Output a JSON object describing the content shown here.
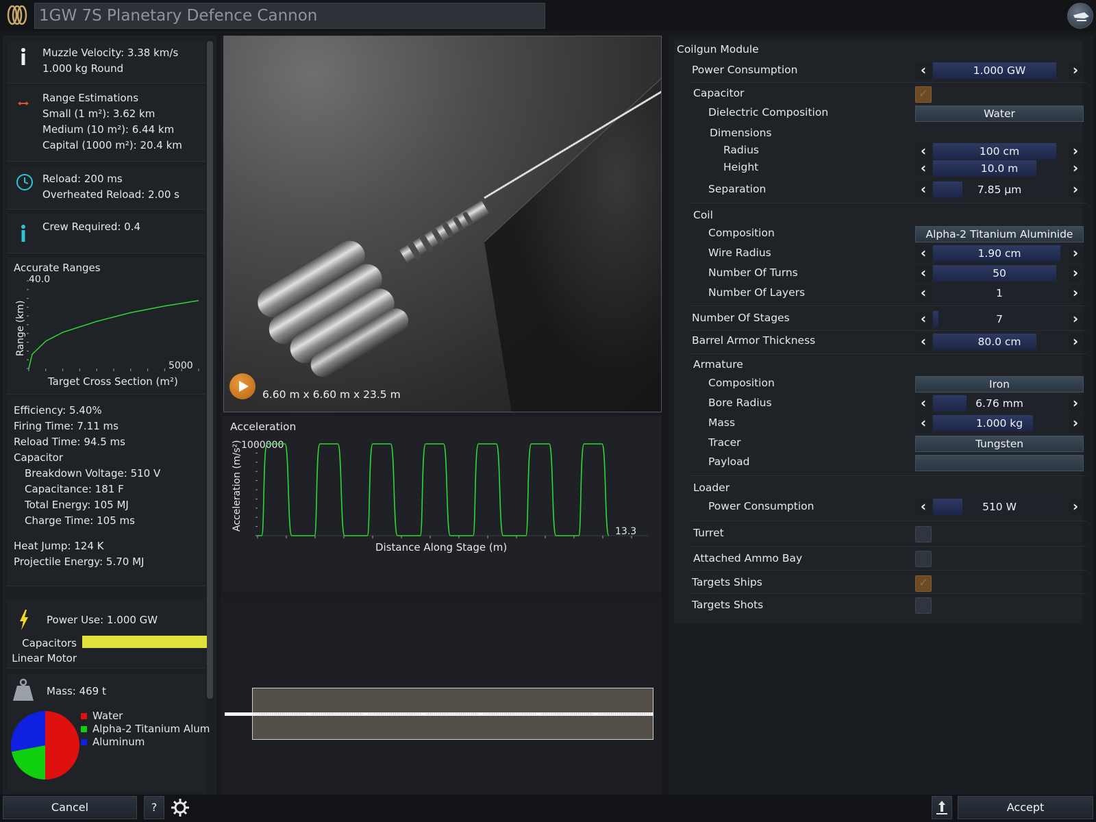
{
  "header": {
    "title": "1GW 7S Planetary Defence Cannon"
  },
  "left": {
    "muzzle": {
      "line1": "Muzzle Velocity: 3.38 km/s",
      "line2": "1.000 kg Round"
    },
    "range": {
      "heading": "Range Estimations",
      "small": "Small (1 m²): 3.62 km",
      "medium": "Medium (10 m²): 6.44 km",
      "capital": "Capital (1000 m²): 20.4 km"
    },
    "reload": {
      "line1": "Reload: 200 ms",
      "line2": "Overheated Reload: 2.00 s"
    },
    "crew": "Crew Required: 0.4",
    "accurate_chart": {
      "title": "Accurate Ranges",
      "ylabel": "Range (km)",
      "xlabel": "Target Cross Section (m²)",
      "ymax_label": "40.0",
      "xmax_label": "5000"
    },
    "stats": {
      "efficiency": "Efficiency: 5.40%",
      "firing_time": "Firing Time: 7.11 ms",
      "reload_time": "Reload Time: 94.5 ms",
      "capacitor_heading": "Capacitor",
      "breakdown": "Breakdown Voltage: 510 V",
      "capacitance": "Capacitance: 181 F",
      "total_energy": "Total Energy: 105 MJ",
      "charge_time": "Charge Time: 105 ms",
      "heat_jump": "Heat Jump: 124 K",
      "projectile_energy": "Projectile Energy: 5.70 MJ"
    },
    "power": {
      "label": "Power Use: 1.000 GW",
      "capacitors": "Capacitors",
      "linear_motor": "Linear Motor",
      "capacitors_fill": 1.0,
      "linear_motor_fill": 0.0,
      "bar_color": "#e2e03a"
    },
    "mass": {
      "label": "Mass: 469 t",
      "legend": [
        {
          "name": "Water",
          "color": "#e01010"
        },
        {
          "name": "Alpha-2 Titanium Alum",
          "color": "#10d010"
        },
        {
          "name": "Aluminum",
          "color": "#1020e0"
        }
      ]
    }
  },
  "viewport": {
    "dimensions": "6.60 m x 6.60 m x 23.5 m"
  },
  "accel_chart": {
    "title": "Acceleration",
    "ylabel": "Acceleration (m/s²)",
    "xlabel": "Distance Along Stage (m)",
    "ymax_label": "1000000",
    "xmax_label": "13.3"
  },
  "right": {
    "module_title": "Coilgun Module",
    "power_consumption": {
      "label": "Power Consumption",
      "value": "1.000 GW",
      "fill": 0.93
    },
    "capacitor": {
      "label": "Capacitor",
      "checked": true
    },
    "dielectric": {
      "label": "Dielectric Composition",
      "value": "Water"
    },
    "dimensions": {
      "label": "Dimensions"
    },
    "radius": {
      "label": "Radius",
      "value": "100 cm",
      "fill": 0.93
    },
    "height": {
      "label": "Height",
      "value": "10.0 m",
      "fill": 0.78
    },
    "separation": {
      "label": "Separation",
      "value": "7.85 μm",
      "fill": 0.22
    },
    "coil": {
      "label": "Coil"
    },
    "coil_composition": {
      "label": "Composition",
      "value": "Alpha-2 Titanium Aluminide"
    },
    "wire_radius": {
      "label": "Wire Radius",
      "value": "1.90 cm",
      "fill": 0.96
    },
    "turns": {
      "label": "Number Of Turns",
      "value": "50",
      "fill": 0.93
    },
    "layers": {
      "label": "Number Of Layers",
      "value": "1",
      "fill": 0.0
    },
    "stages": {
      "label": "Number Of Stages",
      "value": "7",
      "fill": 0.04
    },
    "barrel_armor": {
      "label": "Barrel Armor Thickness",
      "value": "80.0 cm",
      "fill": 0.78
    },
    "armature": {
      "label": "Armature"
    },
    "arm_composition": {
      "label": "Composition",
      "value": "Iron"
    },
    "bore_radius": {
      "label": "Bore Radius",
      "value": "6.76 mm",
      "fill": 0.25
    },
    "mass": {
      "label": "Mass",
      "value": "1.000 kg",
      "fill": 0.75
    },
    "tracer": {
      "label": "Tracer",
      "value": "Tungsten"
    },
    "payload": {
      "label": "Payload",
      "value": ""
    },
    "loader": {
      "label": "Loader"
    },
    "loader_power": {
      "label": "Power Consumption",
      "value": "510 W",
      "fill": 0.22
    },
    "turret": {
      "label": "Turret",
      "checked": false
    },
    "ammo_bay": {
      "label": "Attached Ammo Bay",
      "checked": false
    },
    "targets_ships": {
      "label": "Targets Ships",
      "checked": true
    },
    "targets_shots": {
      "label": "Targets Shots",
      "checked": false
    }
  },
  "footer": {
    "cancel": "Cancel",
    "help": "?",
    "accept": "Accept"
  },
  "chart_data": [
    {
      "type": "line",
      "title": "Accurate Ranges",
      "xlabel": "Target Cross Section (m²)",
      "ylabel": "Range (km)",
      "xlim": [
        0,
        5000
      ],
      "ylim": [
        0,
        40
      ],
      "x": [
        0,
        100,
        500,
        1000,
        2000,
        3000,
        4000,
        5000
      ],
      "series": [
        {
          "values": [
            0,
            6.5,
            12.5,
            16.5,
            21.5,
            25.5,
            28.5,
            31.0
          ]
        }
      ],
      "color": "#2ed82e"
    },
    {
      "type": "line",
      "title": "Acceleration",
      "xlabel": "Distance Along Stage (m)",
      "ylabel": "Acceleration (m/s²)",
      "xlim": [
        0,
        13.3
      ],
      "ylim": [
        0,
        1000000
      ],
      "pulses": 7,
      "pulse_peak": 1000000,
      "color": "#2ed82e"
    }
  ]
}
